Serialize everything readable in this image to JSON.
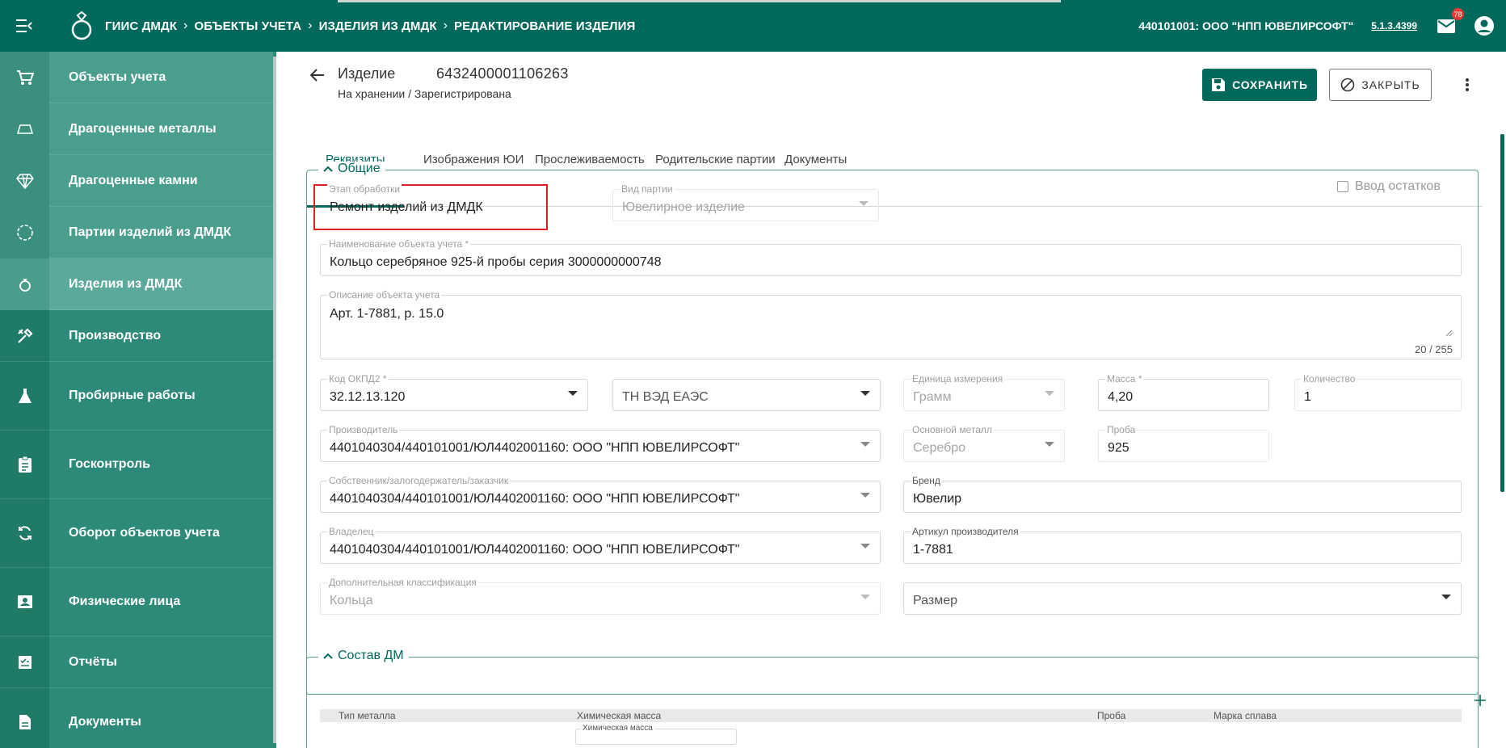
{
  "header": {
    "breadcrumbs": [
      "ГИИС ДМДК",
      "ОБЪЕКТЫ УЧЕТА",
      "ИЗДЕЛИЯ ИЗ ДМДК",
      "РЕДАКТИРОВАНИЕ ИЗДЕЛИЯ"
    ],
    "org": "440101001: ООО \"НПП ЮВЕЛИРСОФТ\"",
    "version": "5.1.3.4399",
    "mail_badge": "78",
    "icons": {
      "menu": "menu-collapse-icon",
      "logo": "ring-logo-icon",
      "mail": "mail-icon",
      "user": "account-icon",
      "chevron": "chevron-right-icon"
    }
  },
  "sidebar": {
    "items": [
      {
        "label": "Объекты учета",
        "icon": "cart-icon"
      },
      {
        "label": "Драгоценные металлы",
        "icon": "ingot-icon"
      },
      {
        "label": "Драгоценные камни",
        "icon": "diamond-icon"
      },
      {
        "label": "Партии изделий из ДМДК",
        "icon": "dashed-circle-icon"
      },
      {
        "label": "Изделия из ДМДК",
        "icon": "ring-icon",
        "active": true
      },
      {
        "label": "Производство",
        "icon": "tools-icon"
      },
      {
        "label": "Пробирные работы",
        "icon": "flask-icon"
      },
      {
        "label": "Госконтроль",
        "icon": "clipboard-icon"
      },
      {
        "label": "Оборот объектов учета",
        "icon": "sync-icon"
      },
      {
        "label": "Физические лица",
        "icon": "contact-card-icon"
      },
      {
        "label": "Отчёты",
        "icon": "report-check-icon"
      },
      {
        "label": "Документы",
        "icon": "document-icon"
      }
    ]
  },
  "page": {
    "title": "Изделие",
    "number": "6432400001106263",
    "status": "На хранении / Зарегистрирована",
    "save_label": "СОХРАНИТЬ",
    "close_label": "ЗАКРЫТЬ"
  },
  "tabs": [
    "Реквизиты",
    "Изображения ЮИ",
    "Прослеживаемость",
    "Родительские партии",
    "Документы"
  ],
  "general": {
    "legend": "Общие",
    "stage": {
      "label": "Этап обработки",
      "value": "Ремонт изделий из ДМДК"
    },
    "batch_kind": {
      "label": "Вид партии",
      "value": "Ювелирное изделие"
    },
    "residue_checkbox": {
      "label": "Ввод остатков",
      "checked": false
    },
    "name": {
      "label": "Наименование объекта учета *",
      "value": "Кольцо серебряное 925-й пробы серия 3000000000748"
    },
    "description": {
      "label": "Описание объекта учета",
      "value": "Арт. 1-7881, р. 15.0",
      "counter": "20 / 255"
    },
    "okpd2": {
      "label": "Код ОКПД2 *",
      "value": "32.12.13.120"
    },
    "tnved": {
      "label": "",
      "value": "ТН ВЭД ЕАЭС"
    },
    "unit": {
      "label": "Единица измерения",
      "value": "Грамм"
    },
    "mass": {
      "label": "Масса *",
      "value": "4,20"
    },
    "quantity": {
      "label": "Количество",
      "value": "1"
    },
    "producer": {
      "label": "Производитель",
      "value": "4401040304/440101001/ЮЛ4402001160: ООО \"НПП ЮВЕЛИРСОФТ\""
    },
    "main_metal": {
      "label": "Основной металл",
      "value": "Серебро"
    },
    "probe": {
      "label": "Проба",
      "value": "925"
    },
    "owner_pledge": {
      "label": "Собственник/залогодержатель/заказчик",
      "value": "4401040304/440101001/ЮЛ4402001160: ООО \"НПП ЮВЕЛИРСОФТ\""
    },
    "brand": {
      "label": "Бренд",
      "value": "Ювелир"
    },
    "holder": {
      "label": "Владелец",
      "value": "4401040304/440101001/ЮЛ4402001160: ООО \"НПП ЮВЕЛИРСОФТ\""
    },
    "article": {
      "label": "Артикул производителя",
      "value": "1-7881"
    },
    "extra_class": {
      "label": "Дополнительная классификация",
      "value": "Кольца"
    },
    "size": {
      "label": "",
      "value": "Размер"
    }
  },
  "composition": {
    "legend": "Состав ДМ",
    "columns": [
      "Тип металла",
      "Химическая масса",
      "Проба",
      "Марка сплава"
    ],
    "row_field_label": "Химическая масса"
  },
  "colors": {
    "brand": "#00695c",
    "sidebar": "#2e8a78",
    "highlight": "#e02020",
    "badge": "#e53935"
  }
}
